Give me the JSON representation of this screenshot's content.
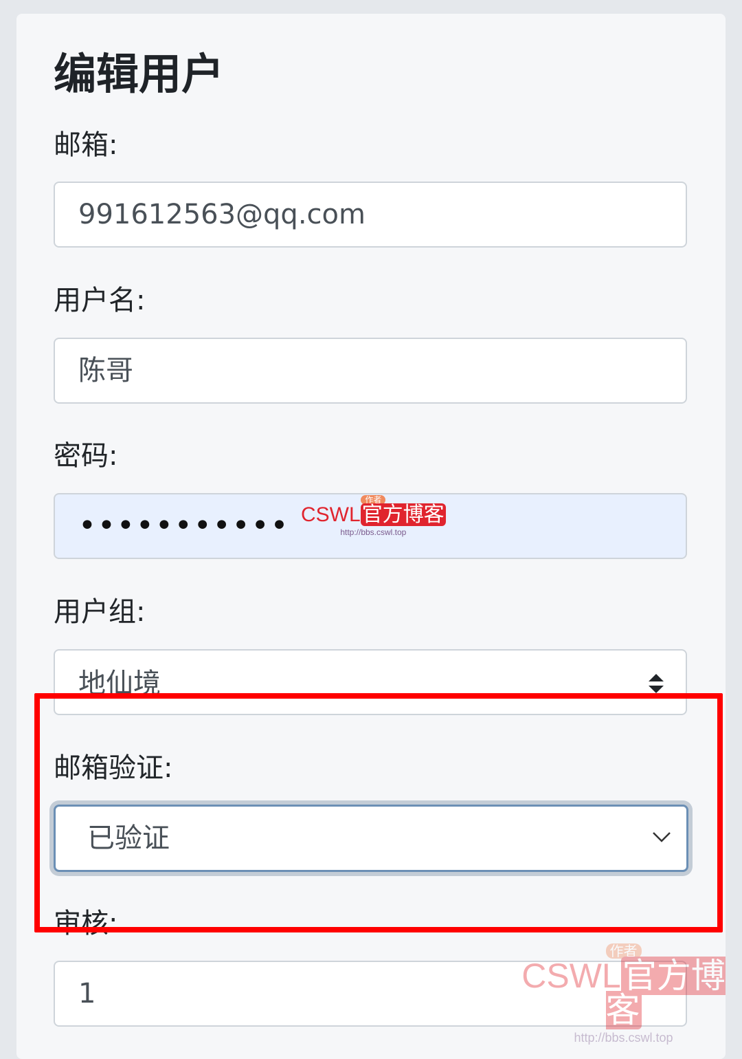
{
  "form": {
    "title": "编辑用户",
    "email": {
      "label": "邮箱:",
      "value": "991612563@qq.com"
    },
    "username": {
      "label": "用户名:",
      "value": "陈哥"
    },
    "password": {
      "label": "密码:",
      "value": "•••••••••••"
    },
    "group": {
      "label": "用户组:",
      "value": "地仙境"
    },
    "email_verify": {
      "label": "邮箱验证:",
      "value": "已验证"
    },
    "review": {
      "label": "审核:",
      "value": "1"
    }
  },
  "watermark": {
    "badge": "作者",
    "brand_latin": "CSWL",
    "brand_cn": "官方博客",
    "url": "http://bbs.cswl.top"
  },
  "colors": {
    "highlight_box": "#ff0000",
    "autofill_bg": "#e8f0fe",
    "focus_border": "#6b8fb5"
  }
}
